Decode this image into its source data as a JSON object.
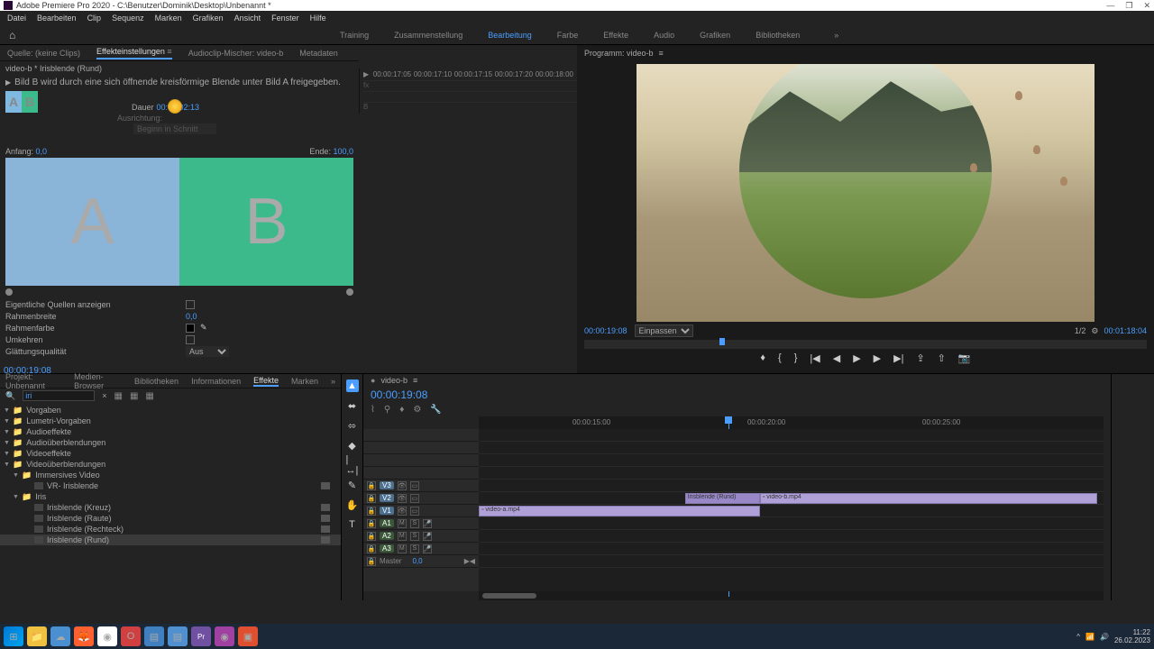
{
  "titlebar": {
    "title": "Adobe Premiere Pro 2020 - C:\\Benutzer\\Dominik\\Desktop\\Unbenannt *"
  },
  "menu": [
    "Datei",
    "Bearbeiten",
    "Clip",
    "Sequenz",
    "Marken",
    "Grafiken",
    "Ansicht",
    "Fenster",
    "Hilfe"
  ],
  "workspaces": [
    "Training",
    "Zusammenstellung",
    "Bearbeitung",
    "Farbe",
    "Effekte",
    "Audio",
    "Grafiken",
    "Bibliotheken"
  ],
  "workspaces_active": "Bearbeitung",
  "effect_tabs": [
    "Quelle: (keine Clips)",
    "Effekteinstellungen",
    "Audioclip-Mischer: video-b",
    "Metadaten"
  ],
  "effect_tabs_active": "Effekteinstellungen",
  "src_label": "video-b * Irisblende (Rund)",
  "fx_desc": "Bild B wird durch eine sich öffnende kreisförmige Blende unter Bild A freigegeben.",
  "fx_duration_label": "Dauer",
  "fx_duration_value": "00:00:02:13",
  "fx_align_label": "Ausrichtung:",
  "fx_align_value": "Beginn in Schnitt",
  "fx_start_label": "Anfang:",
  "fx_start_value": "0,0",
  "fx_end_label": "Ende:",
  "fx_end_value": "100,0",
  "fx_params": {
    "show_sources": "Eigentliche Quellen anzeigen",
    "border_width": "Rahmenbreite",
    "border_width_val": "0,0",
    "border_color": "Rahmenfarbe",
    "invert": "Umkehren",
    "smoothing": "Glättungsqualität",
    "smoothing_val": "Aus"
  },
  "mini_ticks": [
    "00:00:17:05",
    "00:00:17:10",
    "00:00:17:15",
    "00:00:17:20",
    "00:00:18:00"
  ],
  "fx_timecode": "00:00:19:08",
  "program": {
    "label": "Programm: video-b",
    "timecode": "00:00:19:08",
    "fit": "Einpassen",
    "zoom": "1/2",
    "duration": "00:01:18:04"
  },
  "project_tabs": [
    "Projekt: Unbenannt",
    "Medien-Browser",
    "Bibliotheken",
    "Informationen",
    "Effekte",
    "Marken"
  ],
  "project_tabs_active": "Effekte",
  "search_value": "iri",
  "effects_tree": [
    {
      "level": 0,
      "type": "folder",
      "label": "Vorgaben",
      "open": true
    },
    {
      "level": 0,
      "type": "folder",
      "label": "Lumetri-Vorgaben",
      "open": true
    },
    {
      "level": 0,
      "type": "folder",
      "label": "Audioeffekte",
      "open": true
    },
    {
      "level": 0,
      "type": "folder",
      "label": "Audioüberblendungen",
      "open": true
    },
    {
      "level": 0,
      "type": "folder",
      "label": "Videoeffekte",
      "open": true
    },
    {
      "level": 0,
      "type": "folder",
      "label": "Videoüberblendungen",
      "open": true
    },
    {
      "level": 1,
      "type": "folder",
      "label": "Immersives Video",
      "open": true
    },
    {
      "level": 2,
      "type": "fx",
      "label": "VR- Irisblende",
      "badge": true
    },
    {
      "level": 1,
      "type": "folder",
      "label": "Iris",
      "open": true
    },
    {
      "level": 2,
      "type": "fx",
      "label": "Irisblende (Kreuz)",
      "badge": true
    },
    {
      "level": 2,
      "type": "fx",
      "label": "Irisblende (Raute)",
      "badge": true
    },
    {
      "level": 2,
      "type": "fx",
      "label": "Irisblende (Rechteck)",
      "badge": true
    },
    {
      "level": 2,
      "type": "fx",
      "label": "Irisblende (Rund)",
      "badge": true,
      "selected": true
    }
  ],
  "timeline": {
    "seq_name": "video-b",
    "timecode": "00:00:19:08",
    "ruler": [
      "00:00:15:00",
      "00:00:20:00",
      "00:00:25:00"
    ],
    "tracks_v": [
      "V3",
      "V2",
      "V1"
    ],
    "tracks_a": [
      "A1",
      "A2",
      "A3"
    ],
    "master": "Master",
    "master_val": "0,0",
    "clip_trans": "Irisblende (Rund)",
    "clip_b": "video-b.mp4",
    "clip_a": "video-a.mp4"
  },
  "taskbar": {
    "time": "11:22",
    "date": "26.02.2023"
  }
}
